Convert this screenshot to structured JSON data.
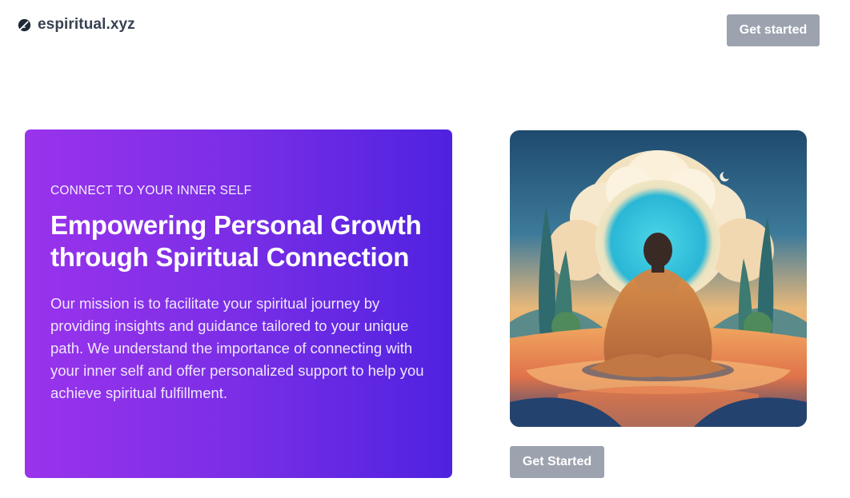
{
  "header": {
    "brand": "espiritual.xyz",
    "brand_icon": "feather-logo-icon",
    "cta_label": "Get started"
  },
  "hero": {
    "eyebrow": "CONNECT TO YOUR INNER SELF",
    "headline": "Empowering Personal Growth through Spiritual Connection",
    "description": "Our mission is to facilitate your spiritual journey by providing insights and guidance tailored to your unique path. We understand the importance of connecting with your inner self and offer personalized support to help you achieve spiritual fulfillment.",
    "gradient_colors": [
      "#9a33ec",
      "#4f22e0"
    ]
  },
  "illustration": {
    "subject": "meditating-person-illustration"
  },
  "cta": {
    "label": "Get Started",
    "color": "#9ca3af"
  }
}
